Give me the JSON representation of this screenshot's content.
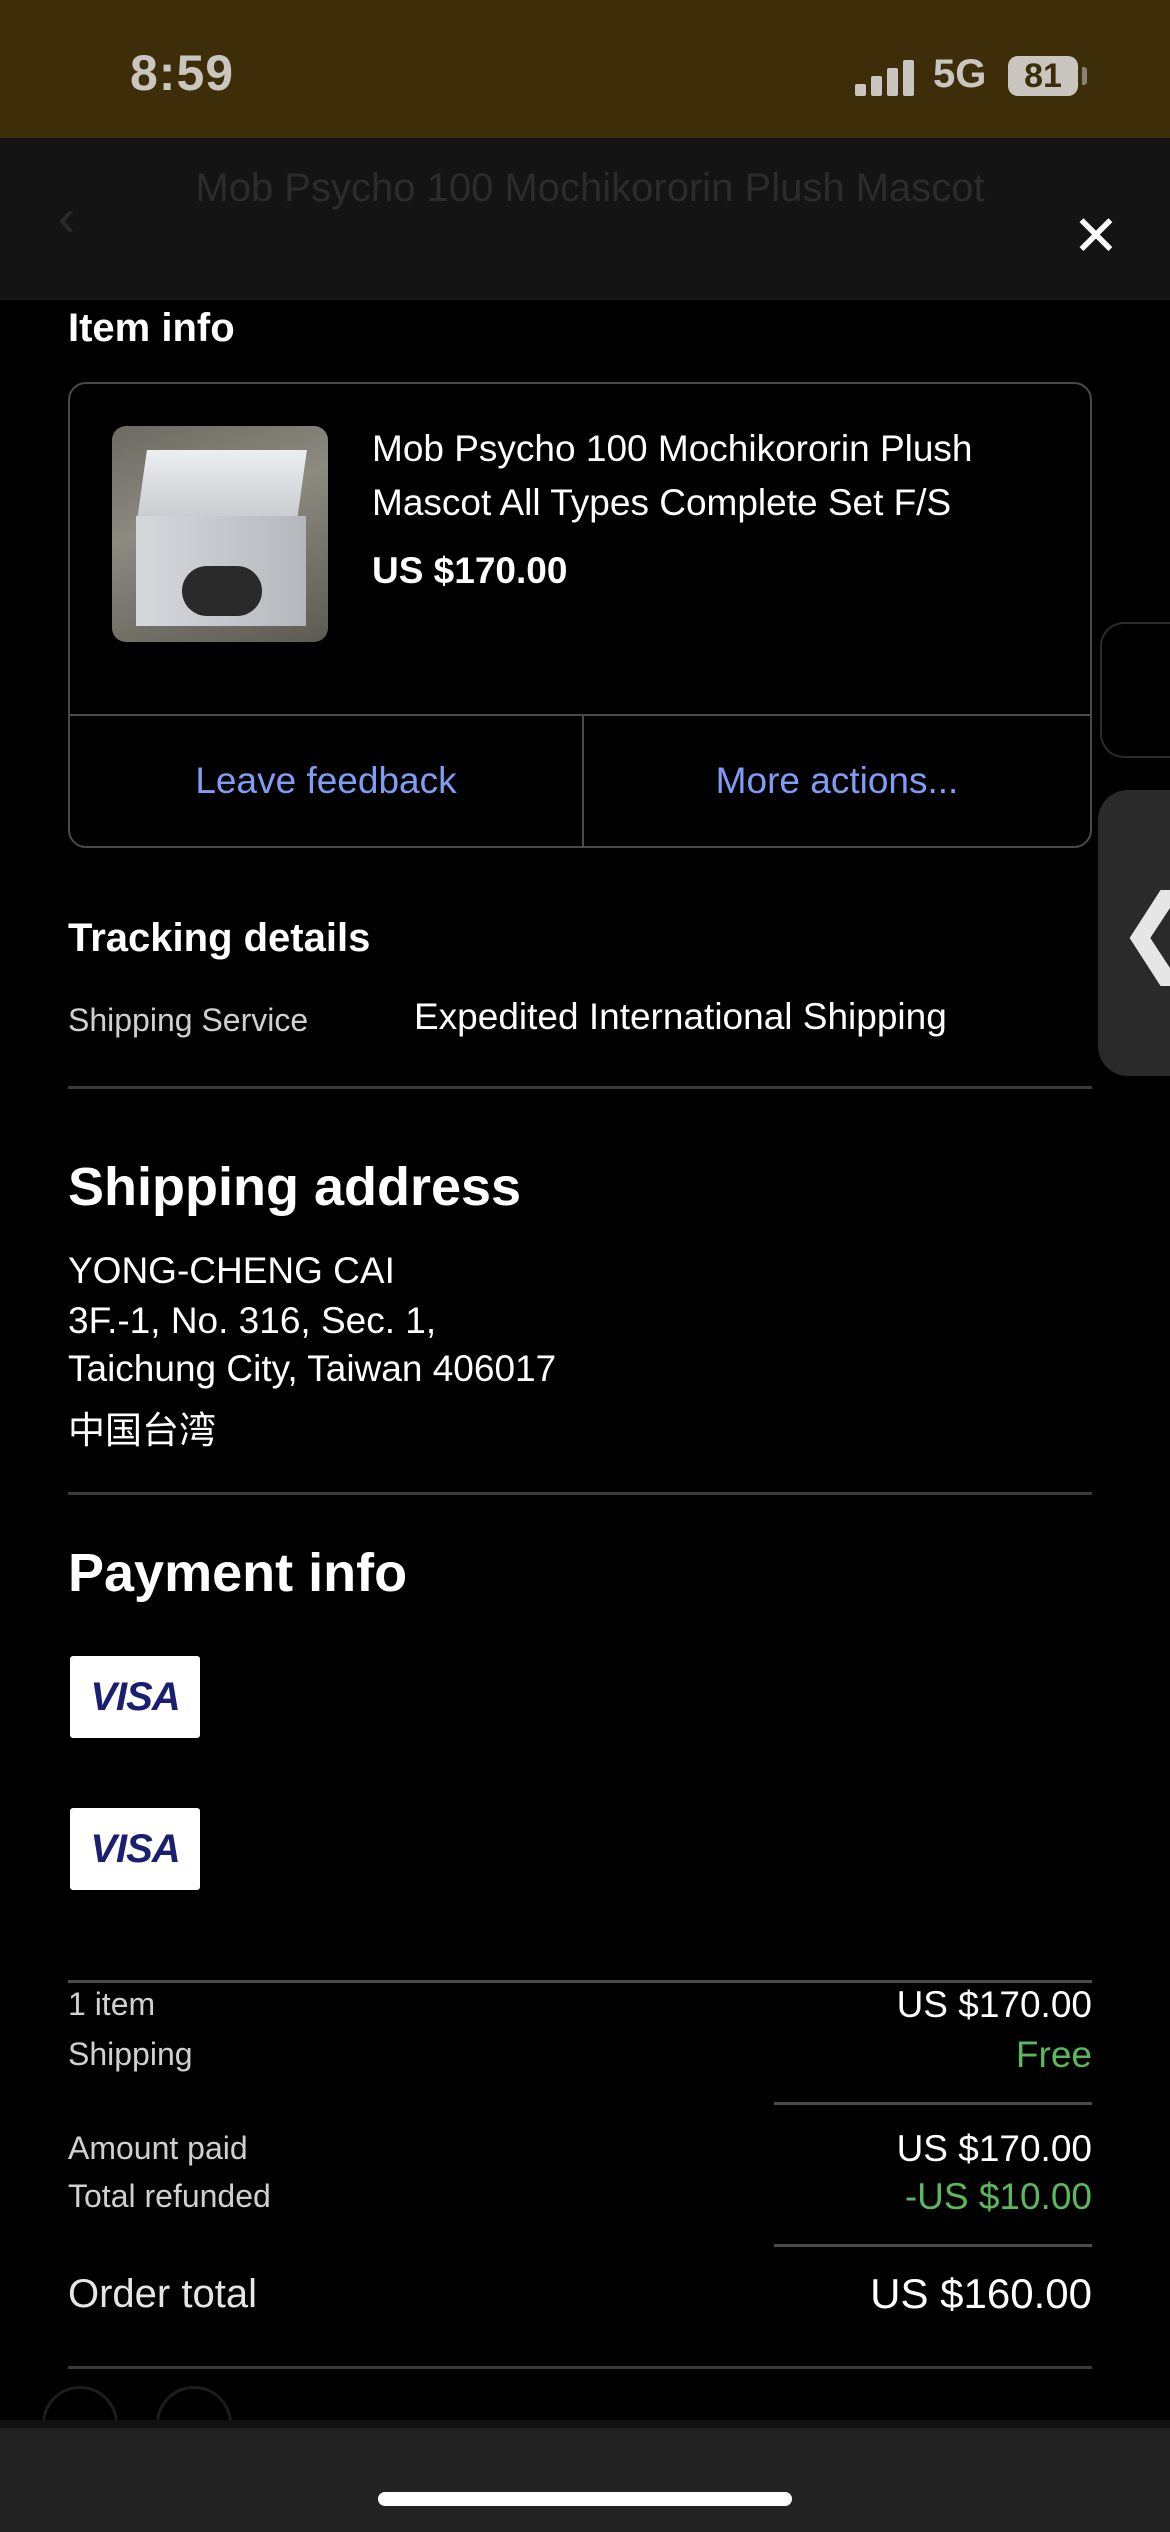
{
  "status_bar": {
    "time": "8:59",
    "network": "5G",
    "battery": "81"
  },
  "background_page": {
    "title": "Mob Psycho 100 Mochikororin Plush Mascot"
  },
  "item_info": {
    "section_title": "Item info",
    "item_title": "Mob Psycho 100 Mochikororin Plush Mascot All Types Complete Set F/S",
    "price": "US $170.00",
    "thumbnail_icon": "product-box-image",
    "actions": [
      {
        "label": "Leave feedback"
      },
      {
        "label": "More actions..."
      }
    ],
    "action_color": "#7f9df5"
  },
  "tracking": {
    "section_title": "Tracking details",
    "service_label": "Shipping Service",
    "service_value": "Expedited International Shipping"
  },
  "shipping_address": {
    "section_title": "Shipping address",
    "lines": [
      "YONG-CHENG CAI",
      "3F.-1, No. 316, Sec. 1,",
      "Taichung City, Taiwan 406017",
      "中国台湾"
    ]
  },
  "payment_info": {
    "section_title": "Payment info",
    "cards": [
      {
        "brand": "VISA"
      },
      {
        "brand": "VISA"
      }
    ]
  },
  "order_summary": {
    "items_label": "1 item",
    "items_value": "US $170.00",
    "shipping_label": "Shipping",
    "shipping_value": "Free",
    "amount_paid_label": "Amount paid",
    "amount_paid_value": "US $170.00",
    "refunded_label": "Total refunded",
    "refunded_value": "-US $10.00",
    "order_total_label": "Order total",
    "order_total_value": "US $160.00",
    "positive_color": "#5cb85c"
  },
  "icons": {
    "close": "close-icon",
    "back": "back-arrow-icon",
    "edge_handle": "chevron-left-icon"
  }
}
